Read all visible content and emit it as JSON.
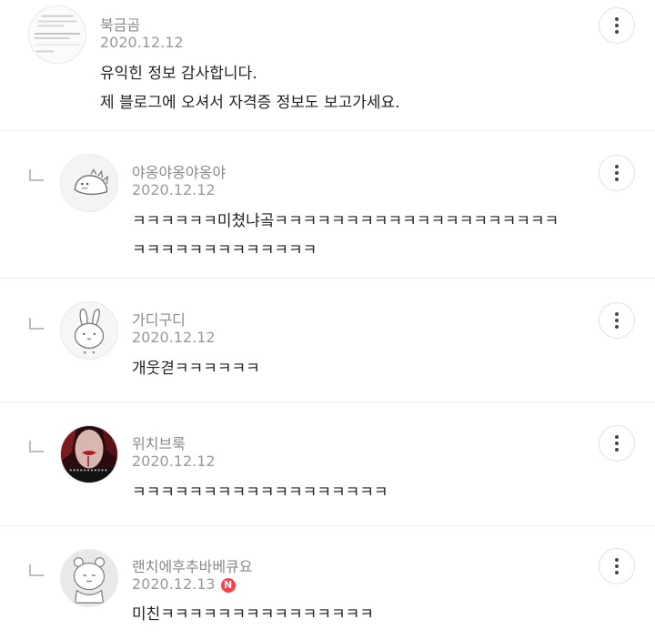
{
  "comments": [
    {
      "author": "북금곰",
      "date": "2020.12.12",
      "lines": [
        "유익힌 정보 감사합니다.",
        "제 블로그에 오셔서 자격증 정보도 보고가세요."
      ],
      "avatar_icon": "document-thumbnail-icon"
    },
    {
      "author": "야옹야옹야옹야",
      "date": "2020.12.12",
      "lines": [
        "ㅋㅋㅋㅋㅋㅋ미쳤냐곸ㅋㅋㅋㅋㅋㅋㅋㅋㅋㅋㅋㅋㅋㅋㅋㅋㅋㅋㅋㅋ",
        "ㅋㅋㅋㅋㅋㅋㅋㅋㅋㅋㅋㅋㅋ"
      ],
      "avatar_icon": "dinosaur-doodle-icon"
    },
    {
      "author": "가디구디",
      "date": "2020.12.12",
      "lines": [
        "개웃겯ㅋㅋㅋㅋㅋㅋ"
      ],
      "avatar_icon": "rabbit-doodle-icon"
    },
    {
      "author": "위치브룩",
      "date": "2020.12.12",
      "lines": [
        "ㅋㅋㅋㅋㅋㅋㅋㅋㅋㅋㅋㅋㅋㅋㅋㅋㅋㅋ"
      ],
      "avatar_icon": "portrait-photo-icon"
    },
    {
      "author": "랜치에후추바베큐요",
      "date": "2020.12.13",
      "badge": "N",
      "lines": [
        "미친ㅋㅋㅋㅋㅋㅋㅋㅋㅋㅋㅋㅋㅋㅋㅋ"
      ],
      "avatar_icon": "bear-doodle-icon"
    }
  ],
  "colors": {
    "badge": "#ff3f48",
    "meta": "#9a9a9a",
    "text": "#222222"
  }
}
